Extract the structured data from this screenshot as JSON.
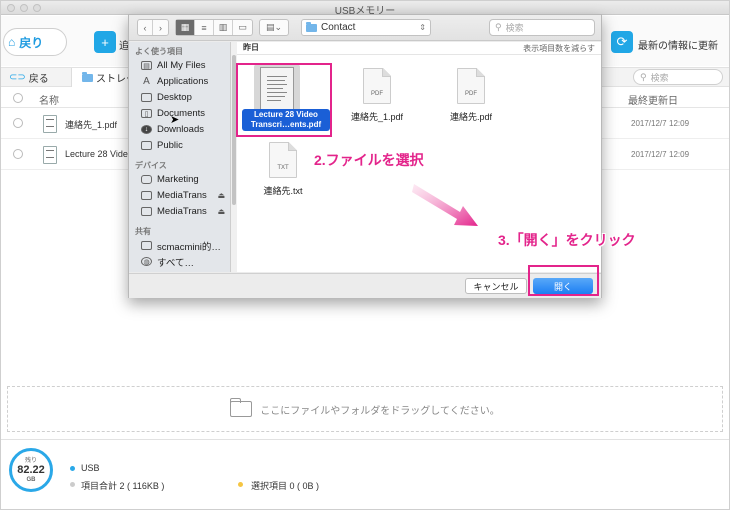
{
  "window": {
    "title": "USBメモリー"
  },
  "toolbar": {
    "back_label": "戻り",
    "add_label_partial": "追",
    "refresh_label": "最新の情報に更新"
  },
  "tabs": {
    "back_tab": "戻る",
    "storage_tab": "ストレー",
    "search_placeholder": "検索"
  },
  "list": {
    "col_name": "名称",
    "col_modified": "最終更新日",
    "rows": [
      {
        "name": "連絡先_1.pdf",
        "date": "2017/12/7",
        "time": "12:09"
      },
      {
        "name": "Lecture 28 Video Tr",
        "date": "2017/12/7",
        "time": "12:09"
      }
    ]
  },
  "dropzone": {
    "text": "ここにファイルやフォルダをドラッグしてください。"
  },
  "status": {
    "gauge_label": "残り",
    "gauge_value": "82.22",
    "gauge_unit": "GB",
    "device": "USB",
    "total_items": "項目合計 2 ( 116KB )",
    "selected_items": "選択項目 0 ( 0B )",
    "colors": {
      "device_dot": "#2aa8e8",
      "total_dot": "#cccccc",
      "selected_dot": "#f5c542"
    }
  },
  "dialog": {
    "path_folder": "Contact",
    "search_placeholder": "検索",
    "section_title": "昨日",
    "section_right": "表示項目数を減らす",
    "sidebar": {
      "favorites_head": "よく使う項目",
      "favorites": [
        {
          "label": "All My Files",
          "icon": "all-files-icon"
        },
        {
          "label": "Applications",
          "icon": "applications-icon"
        },
        {
          "label": "Desktop",
          "icon": "desktop-icon"
        },
        {
          "label": "Documents",
          "icon": "documents-icon"
        },
        {
          "label": "Downloads",
          "icon": "downloads-icon"
        },
        {
          "label": "Public",
          "icon": "public-icon"
        }
      ],
      "devices_head": "デバイス",
      "devices": [
        {
          "label": "Marketing"
        },
        {
          "label": "MediaTrans"
        },
        {
          "label": "MediaTrans"
        }
      ],
      "shared_head": "共有",
      "shared": [
        {
          "label": "scmacmini的…"
        },
        {
          "label": "すべて…"
        }
      ]
    },
    "files": {
      "selected_line1": "Lecture 28 Video",
      "selected_line2": "Transcri…ents.pdf",
      "pdf1_tag": "PDF",
      "pdf1_name": "連絡先_1.pdf",
      "pdf2_tag": "PDF",
      "pdf2_name": "連絡先.pdf",
      "txt_tag": "TXT",
      "txt_name": "連絡先.txt"
    },
    "cancel_label": "キャンセル",
    "open_label": "開く"
  },
  "annotations": {
    "step2": "2.ファイルを選択",
    "step3": "3.「開く」をクリック",
    "highlight_color": "#e3248b"
  }
}
